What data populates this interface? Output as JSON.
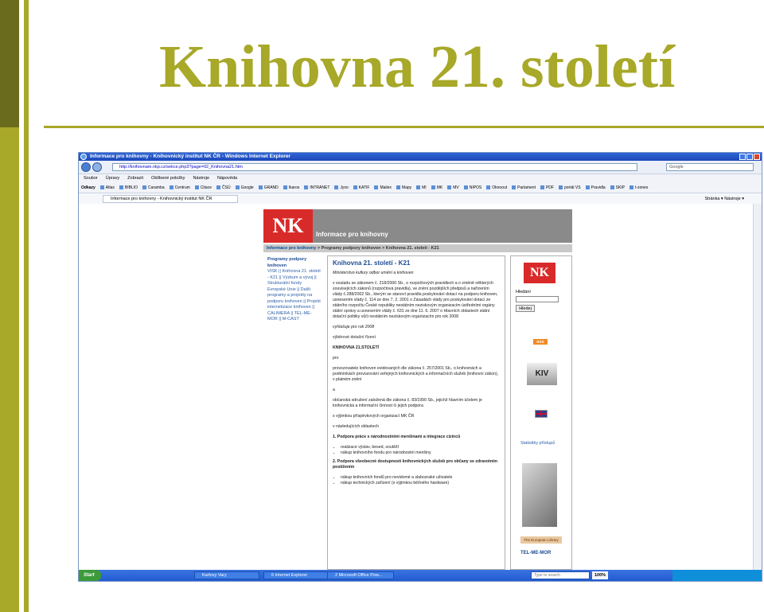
{
  "slide": {
    "title": "Knihovna 21. století",
    "colors": {
      "accent": "#a8a829",
      "accent_dark": "#6b6b1e"
    }
  },
  "browser": {
    "window_title": "Informace pro knihovny - Knihovnický institut NK ČR - Windows Internet Explorer",
    "url": "http://knihovnam.nkp.cz/sekce.php3?page=02_Knihovna21.htm",
    "search_placeholder": "Google",
    "menu": [
      "Soubor",
      "Úpravy",
      "Zobrazit",
      "Oblíbené položky",
      "Nástroje",
      "Nápověda"
    ],
    "links_label": "Odkazy",
    "links": [
      "Atlas",
      "BIBLIO",
      "Caramba",
      "Centrum",
      "Citace",
      "ČSÚ",
      "Google",
      "GRAND",
      "Ikaros",
      "INTRANET",
      "Jyxo",
      "KATIF",
      "Mailex",
      "Mapy",
      "MI",
      "MK",
      "MV",
      "NIPOS",
      "Oknoout",
      "Parlament",
      "PDF",
      "portál VS",
      "Pravidla",
      "SKIP",
      "t-zones"
    ],
    "tab_label": "Informace pro knihovny - Knihovnický institut NK ČR",
    "tab_tools": "Stránka ▾  Nástroje ▾",
    "zoom": "100%"
  },
  "taskbar": {
    "start": "Start",
    "tasks": [
      "Karlovy Vary",
      "6 Internet Explorer",
      "2 Microsoft Office Pow..."
    ],
    "search_placeholder": "Type to search"
  },
  "site": {
    "logo_text": "NK",
    "banner_title": "Informace pro knihovny",
    "breadcrumb_link": "Informace pro knihovny",
    "breadcrumb_rest": " > Programy podpory knihoven > Knihovna 21. století - K21",
    "leftnav_heading": "Programy podpory knihoven",
    "leftnav_text": "VISK || Knihovna 21. století - K21 || Výzkum a vývoj || Strukturální fondy Evropské Unie || Další programy a projekty na podporu knihoven || Projekt internetizace knihoven || CALIMERA || TEL-ME-MOR || M-CAST",
    "content": {
      "heading": "Knihovna 21. století - K21",
      "ministry": "Ministerstvo kultury odbor umění a knihoven",
      "p1": "v souladu se zákonem č. 218/2000 Sb., o rozpočtových pravidlech a o změně některých souvisejících zákonů (rozpočtová pravidla), ve znění pozdějších předpisů a nařízením vlády č.288/2002 Sb., kterým se stanoví pravidla poskytování dotací na podporu knihoven, usnesením vlády č. 114 ze dne 7. 2. 2001 o Zásadách vlády pro poskytování dotací ze státního rozpočtu České republiky nestátním neziskovým organizacím ústředními orgány státní správy a usnesením vlády č. 631 ze dne 11. 6. 2007 o Hlavních oblastech státní dotační politiky vůči nestátním neziskovým organizacím pro rok 2008",
      "p2": "vyhlašuje pro rok 2008",
      "p3": "výběrové dotační řízení",
      "p4": "KNIHOVNA 21.STOLETÍ",
      "p5": "pro",
      "p6": "provozovatele knihoven evidovaných dle zákona č. 257/2001 Sb., o knihovnách a podmínkách provozování veřejných knihovnických a informačních služeb (knihovní zákon), v platném znění",
      "p7": "a",
      "p8": "občanská sdružení založená dle zákona č. 83/1990 Sb., jejichž hlavním účelem je knihovnická a informační činnost či jejich podpora",
      "p9": "s výjimkou příspěvkových organizací MK ČR",
      "p10": "v následujících oblastech",
      "area1": "1. Podpora práce s národnostními menšinami a integrace cizinců",
      "area1_items": [
        "realizace výstav, besed, soutěží",
        "nákup knihovního fondu pro národnostní menšiny"
      ],
      "area2": "2. Podpora všeobecné dostupnosti knihovnických služeb pro občany se zdravotním postižením",
      "area2_items": [
        "nákup knihovních fondů pro nevidomé a slabozraké uživatele",
        "nákup technických zařízení (s výjimkou běžného hardware)"
      ]
    },
    "right": {
      "logo_text": "NK",
      "search_label": "Hledání",
      "search_button": "Hledej",
      "rss": "RSS",
      "kiv": "KIV",
      "stats_link": "Statistiky přístupů",
      "european_library": "The European Library",
      "telmor": "TEL-ME-MOR"
    }
  }
}
